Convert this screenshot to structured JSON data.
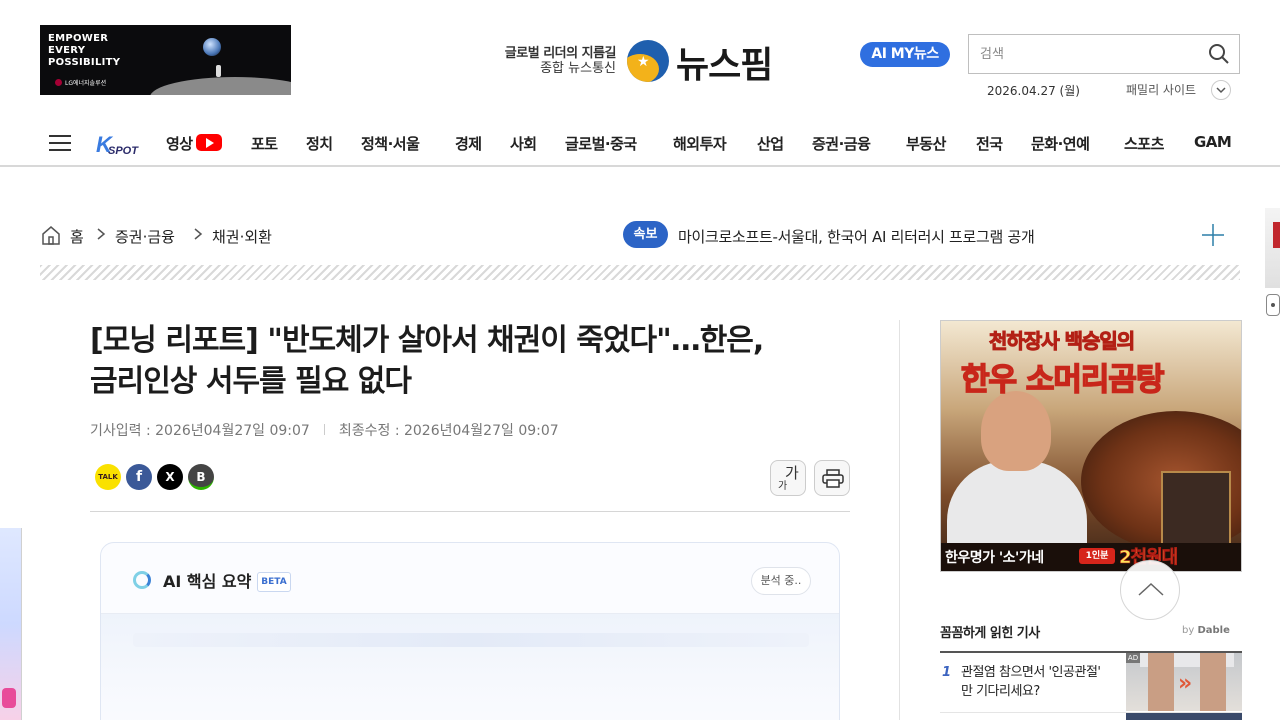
{
  "header": {
    "top_ad": {
      "lines": [
        "EMPOWER",
        "EVERY",
        "POSSIBILITY"
      ],
      "brand": "LG에너지솔루션"
    },
    "slogan_line1": "글로벌 리더의 지름길",
    "slogan_line2": "종합 뉴스통신",
    "logo_text": "뉴스핌",
    "ai_button_label": "AI MY뉴스",
    "search": {
      "placeholder": "검색"
    },
    "date": "2026.04.27 (월)",
    "family_site_label": "패밀리 사이트"
  },
  "nav": {
    "kspot_label": "K SPOT",
    "items": [
      "영상",
      "포토",
      "정치",
      "정책·서울",
      "경제",
      "사회",
      "글로벌·중국",
      "해외투자",
      "산업",
      "증권·금융",
      "부동산",
      "전국",
      "문화·연예",
      "스포츠",
      "GAM"
    ]
  },
  "breadcrumb": {
    "home": "홈",
    "level1": "증권·금융",
    "level2": "채권·외환"
  },
  "breaking": {
    "badge": "속보",
    "text": "마이크로소프트-서울대, 한국어 AI 리터러시 프로그램 공개"
  },
  "article": {
    "title_line1": "[모닝 리포트] \"반도체가 살아서 채권이 죽었다\"…한은,",
    "title_line2": "금리인상 서두를 필요 없다",
    "published": "기사입력 : 2026년04월27일 09:07",
    "modified": "최종수정 : 2026년04월27일 09:07",
    "share": [
      "TALK",
      "f",
      "X",
      "B"
    ],
    "font_button_big": "가",
    "font_button_small": "가"
  },
  "ai_summary": {
    "title": "AI 핵심 요약",
    "beta": "BETA",
    "status": "분석 중.."
  },
  "side_ad": {
    "headline1": "천하장사 백승일의",
    "headline2": "한우 소머리곰탕",
    "strip_text": "한우명가 '소'가네",
    "strip_badge": "1인분",
    "strip_price": "2천원대"
  },
  "recommend": {
    "heading": "꼼꼼하게 읽힌 기사",
    "by": "by",
    "provider": "Dable",
    "items": [
      {
        "num": "1",
        "text": "관절염 참으면서 '인공관절' 만 기다리세요?",
        "ad": "AD"
      }
    ]
  },
  "colors": {
    "accent_blue": "#2c64c6",
    "ai_button": "#2f6fe0",
    "youtube_red": "#ff0000"
  }
}
